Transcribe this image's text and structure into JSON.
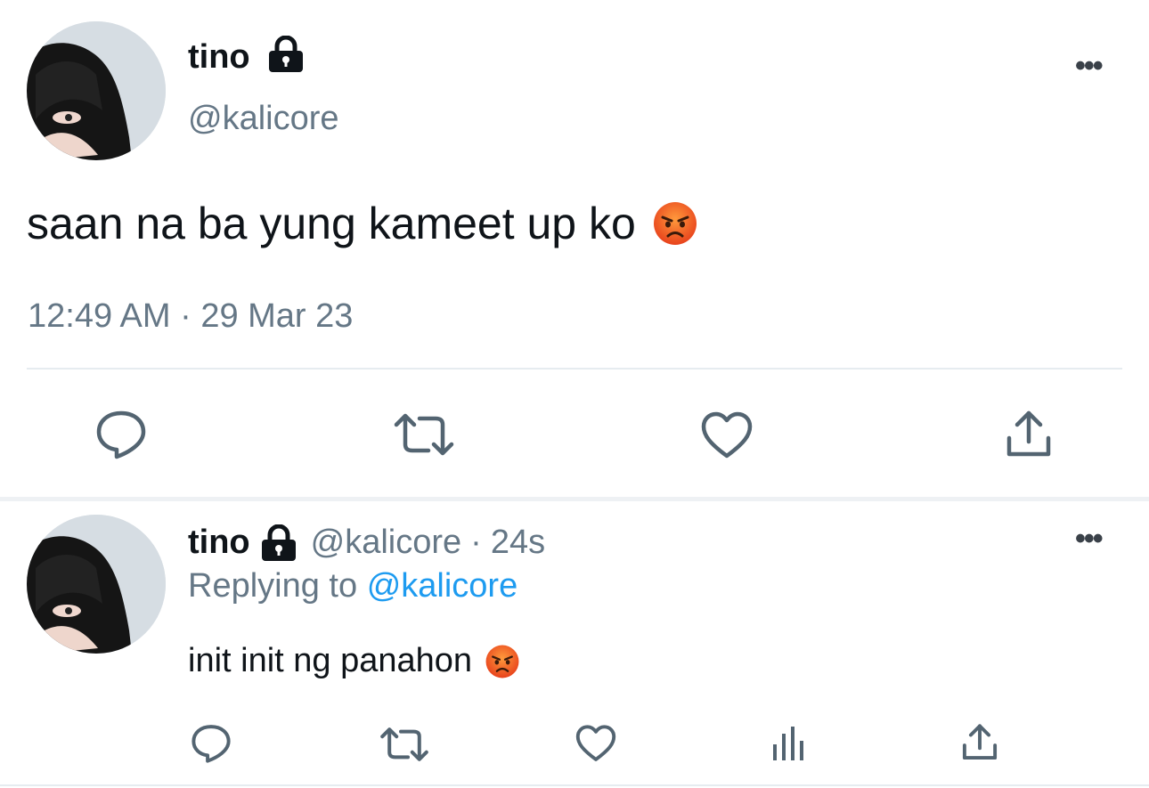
{
  "main_tweet": {
    "display_name": "tino",
    "handle": "@kalicore",
    "text": "saan na ba yung kameet up ko",
    "timestamp": "12:49 AM · 29 Mar 23",
    "emoji": "pouting-face-emoji",
    "lock_icon": "lock-icon"
  },
  "actions": {
    "reply_icon": "reply-icon",
    "retweet_icon": "retweet-icon",
    "like_icon": "heart-icon",
    "share_icon": "share-icon",
    "views_icon": "views-icon"
  },
  "reply_tweet": {
    "display_name": "tino",
    "handle": "@kalicore",
    "separator": "·",
    "age": "24s",
    "replying_prefix": "Replying to",
    "replying_handle": "@kalicore",
    "text": "init init ng panahon",
    "emoji": "pouting-face-emoji"
  },
  "more_label": "•••",
  "colors": {
    "text": "#0f1419",
    "muted": "#657786",
    "link": "#1d9bf0",
    "icon": "#536471",
    "divider": "#e6ecf0",
    "emoji": "#f05a24"
  }
}
